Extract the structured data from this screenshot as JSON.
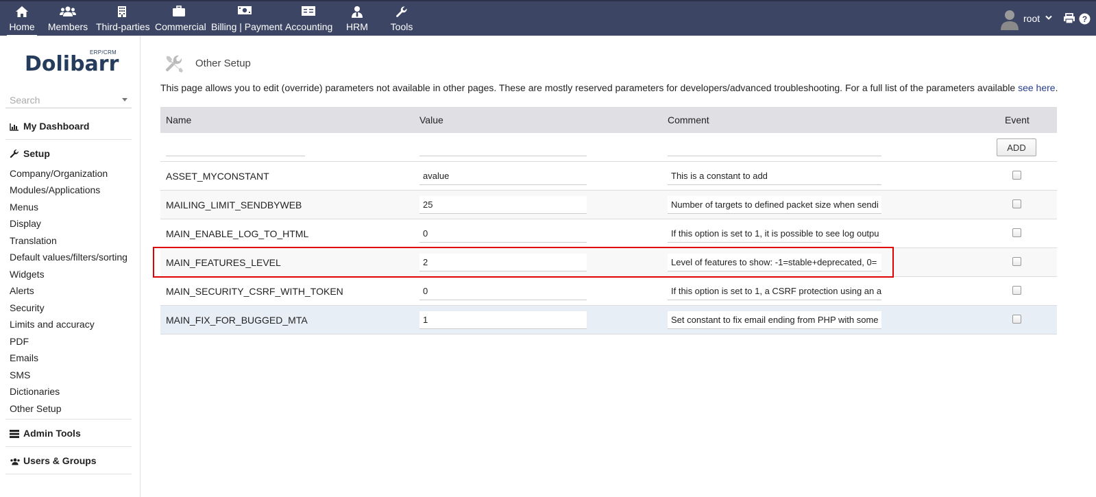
{
  "topnav": {
    "items": [
      {
        "label": "Home",
        "icon": "home-icon"
      },
      {
        "label": "Members",
        "icon": "members-icon"
      },
      {
        "label": "Third-parties",
        "icon": "building-icon"
      },
      {
        "label": "Commercial",
        "icon": "briefcase-icon"
      },
      {
        "label": "Billing | Payment",
        "icon": "money-icon"
      },
      {
        "label": "Accounting",
        "icon": "accounting-icon"
      },
      {
        "label": "HRM",
        "icon": "user-tie-icon"
      },
      {
        "label": "Tools",
        "icon": "wrench-icon"
      }
    ],
    "user": "root",
    "colors": {
      "bar": "#3c4664",
      "text": "#ffffff"
    }
  },
  "sidebar": {
    "logo": "Dolibarr",
    "logo_sup": "ERP/CRM",
    "search_placeholder": "Search",
    "dashboard": "My Dashboard",
    "setup": "Setup",
    "setup_items": [
      "Company/Organization",
      "Modules/Applications",
      "Menus",
      "Display",
      "Translation",
      "Default values/filters/sorting",
      "Widgets",
      "Alerts",
      "Security",
      "Limits and accuracy",
      "PDF",
      "Emails",
      "SMS",
      "Dictionaries",
      "Other Setup"
    ],
    "admin_tools": "Admin Tools",
    "users_groups": "Users & Groups"
  },
  "main": {
    "title": "Other Setup",
    "description": "This page allows you to edit (override) parameters not available in other pages. These are mostly reserved parameters for developers/advanced troubleshooting. For a full list of the parameters available ",
    "link": "see here",
    "description_end": ".",
    "columns": {
      "name": "Name",
      "value": "Value",
      "comment": "Comment",
      "event": "Event"
    },
    "add_label": "ADD",
    "rows": [
      {
        "name": "ASSET_MYCONSTANT",
        "value": "avalue",
        "comment": "This is a constant to add"
      },
      {
        "name": "MAILING_LIMIT_SENDBYWEB",
        "value": "25",
        "comment": "Number of targets to defined packet size when sendi"
      },
      {
        "name": "MAIN_ENABLE_LOG_TO_HTML",
        "value": "0",
        "comment": "If this option is set to 1, it is possible to see log outpu"
      },
      {
        "name": "MAIN_FEATURES_LEVEL",
        "value": "2",
        "comment": "Level of features to show: -1=stable+deprecated, 0="
      },
      {
        "name": "MAIN_SECURITY_CSRF_WITH_TOKEN",
        "value": "0",
        "comment": "If this option is set to 1, a CSRF protection using an a"
      },
      {
        "name": "MAIN_FIX_FOR_BUGGED_MTA",
        "value": "1",
        "comment": "Set constant to fix email ending from PHP with some"
      }
    ],
    "highlight_color": "#e00000"
  }
}
